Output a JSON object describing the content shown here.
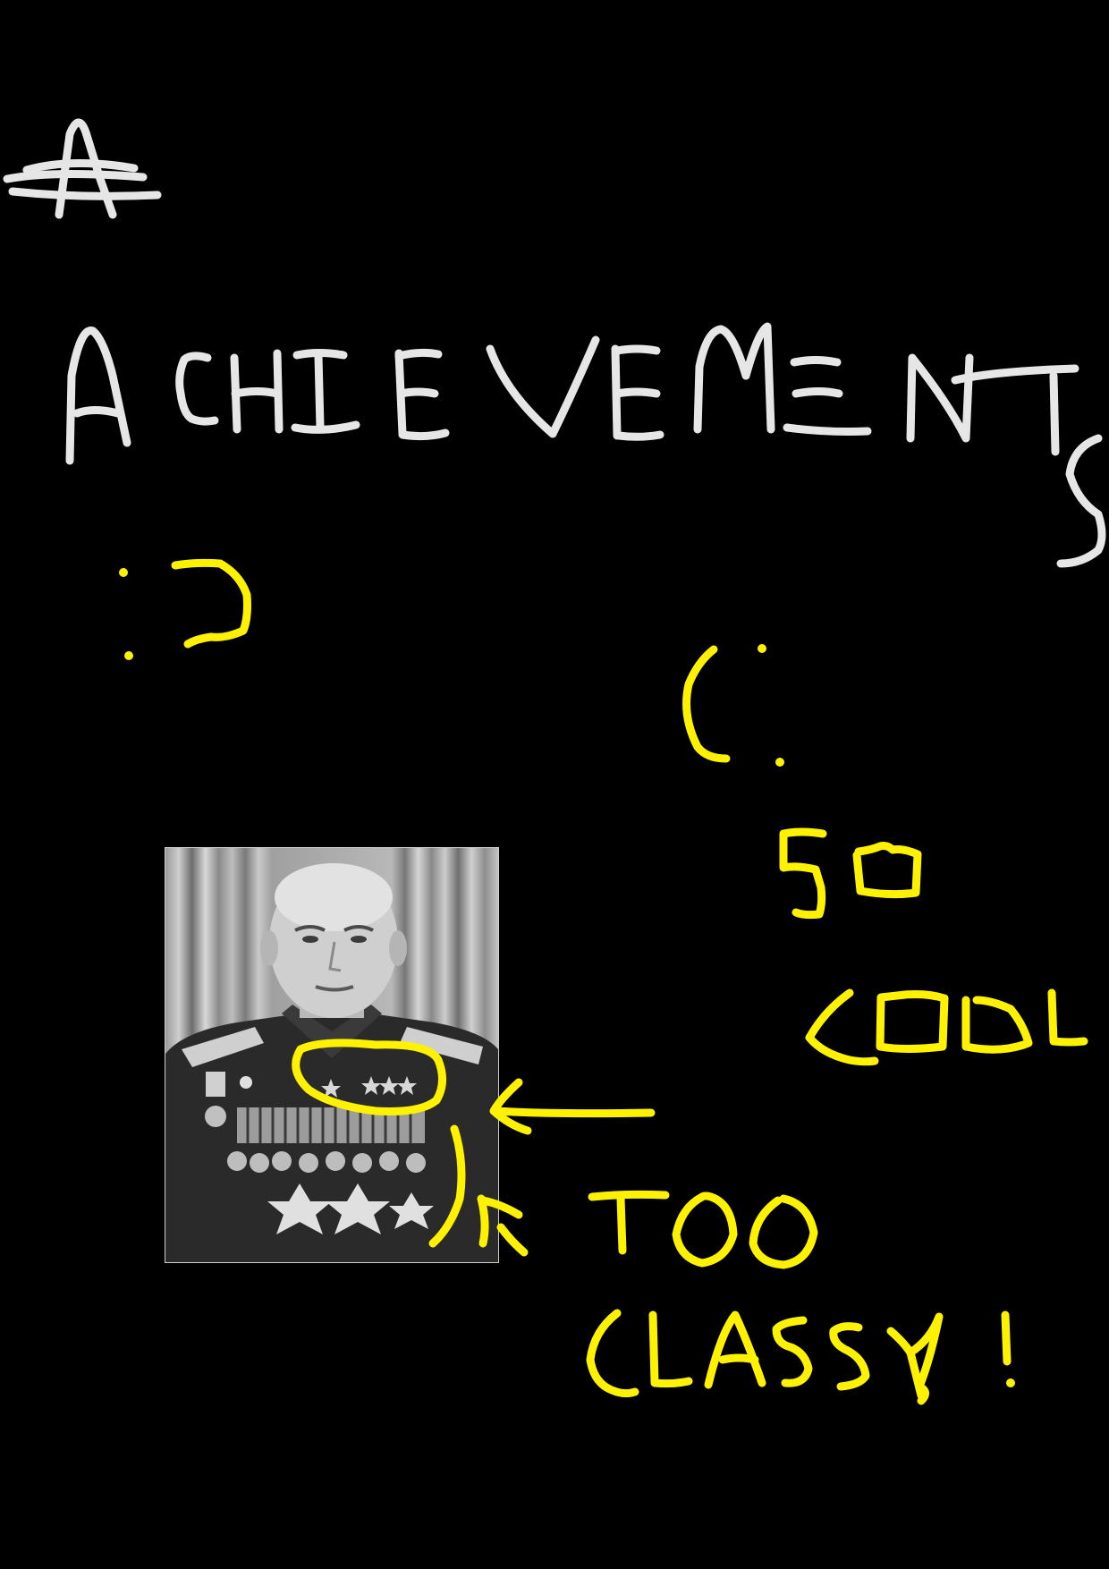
{
  "heading": {
    "crossed_out": "A",
    "title": "ACHIEVEMENTS"
  },
  "faces": {
    "happy": ":)",
    "sad": "(:"
  },
  "annotations": {
    "so_cool": "SO COOL",
    "too_classy": "TOO CLASSY!"
  },
  "photo": {
    "subject": "portrait-of-decorated-officer"
  },
  "colors": {
    "background": "#000000",
    "chalk_white": "#e6e6e6",
    "marker_yellow": "#fff200"
  }
}
